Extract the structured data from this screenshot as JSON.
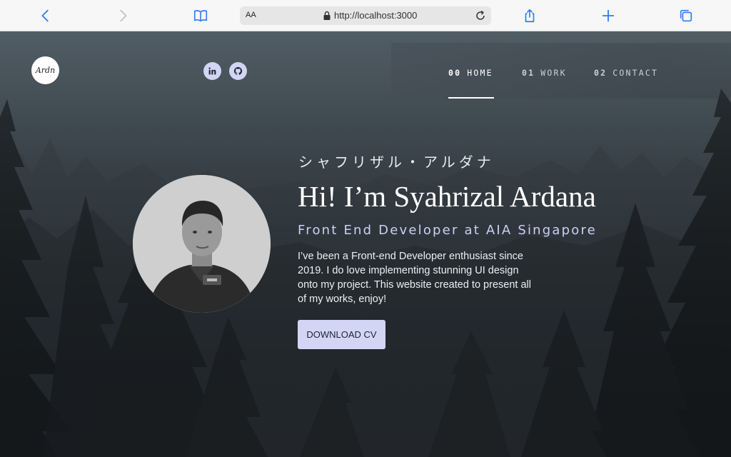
{
  "browser": {
    "url": "http://localhost:3000",
    "text_size_label": "AA"
  },
  "site": {
    "logo_text": "Ardn",
    "social": [
      "linkedin-icon",
      "github-icon"
    ],
    "nav": [
      {
        "num": "00",
        "label": "HOME",
        "active": true
      },
      {
        "num": "01",
        "label": "WORK",
        "active": false
      },
      {
        "num": "02",
        "label": "CONTACT",
        "active": false
      }
    ]
  },
  "hero": {
    "japanese_name": "シャフリザル・アルダナ",
    "greeting": "Hi! I’m Syahrizal Ardana",
    "role": "Front End Developer at AIA Singapore",
    "bio": "I’ve been a Front-end Developer enthusiast since 2019. I do love implementing stunning UI design onto my project. This website created to present all of my works, enjoy!",
    "cta_label": "DOWNLOAD CV"
  },
  "colors": {
    "accent": "#d3d5f4",
    "toolbar_icon": "#2f7cf6"
  }
}
